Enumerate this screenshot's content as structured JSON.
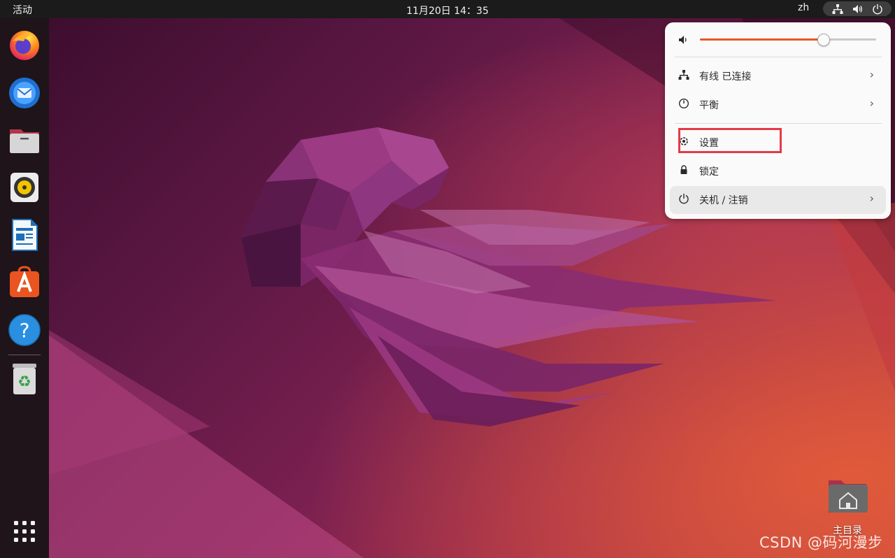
{
  "topbar": {
    "activities": "活动",
    "clock": "11月20日  14：35",
    "input_language": "zh",
    "status_icons": [
      "network-wired-icon",
      "volume-icon",
      "power-icon"
    ]
  },
  "dock": {
    "apps": [
      {
        "name": "firefox-icon"
      },
      {
        "name": "thunderbird-icon"
      },
      {
        "name": "files-icon"
      },
      {
        "name": "rhythmbox-icon"
      },
      {
        "name": "libreoffice-writer-icon"
      },
      {
        "name": "app-center-icon"
      },
      {
        "name": "help-icon"
      },
      {
        "name": "trash-icon"
      }
    ],
    "show_apps": "app-grid-icon"
  },
  "quick_menu": {
    "volume_level": 0.7,
    "items": [
      {
        "label": "有线 已连接",
        "icon": "network-wired-icon",
        "has_submenu": true
      },
      {
        "label": "平衡",
        "icon": "power-profile-icon",
        "has_submenu": true
      },
      {
        "label": "设置",
        "icon": "settings-gear-icon",
        "has_submenu": false
      },
      {
        "label": "锁定",
        "icon": "lock-icon",
        "has_submenu": false
      },
      {
        "label": "关机 / 注销",
        "icon": "power-icon",
        "has_submenu": true
      }
    ],
    "chevron": "›"
  },
  "desktop": {
    "home_folder_label": "主目录"
  },
  "watermark": "CSDN @码河漫步",
  "colors": {
    "accent": "#e95420",
    "highlight_box": "#e63946",
    "topbar_bg": "#1b1b1b"
  }
}
